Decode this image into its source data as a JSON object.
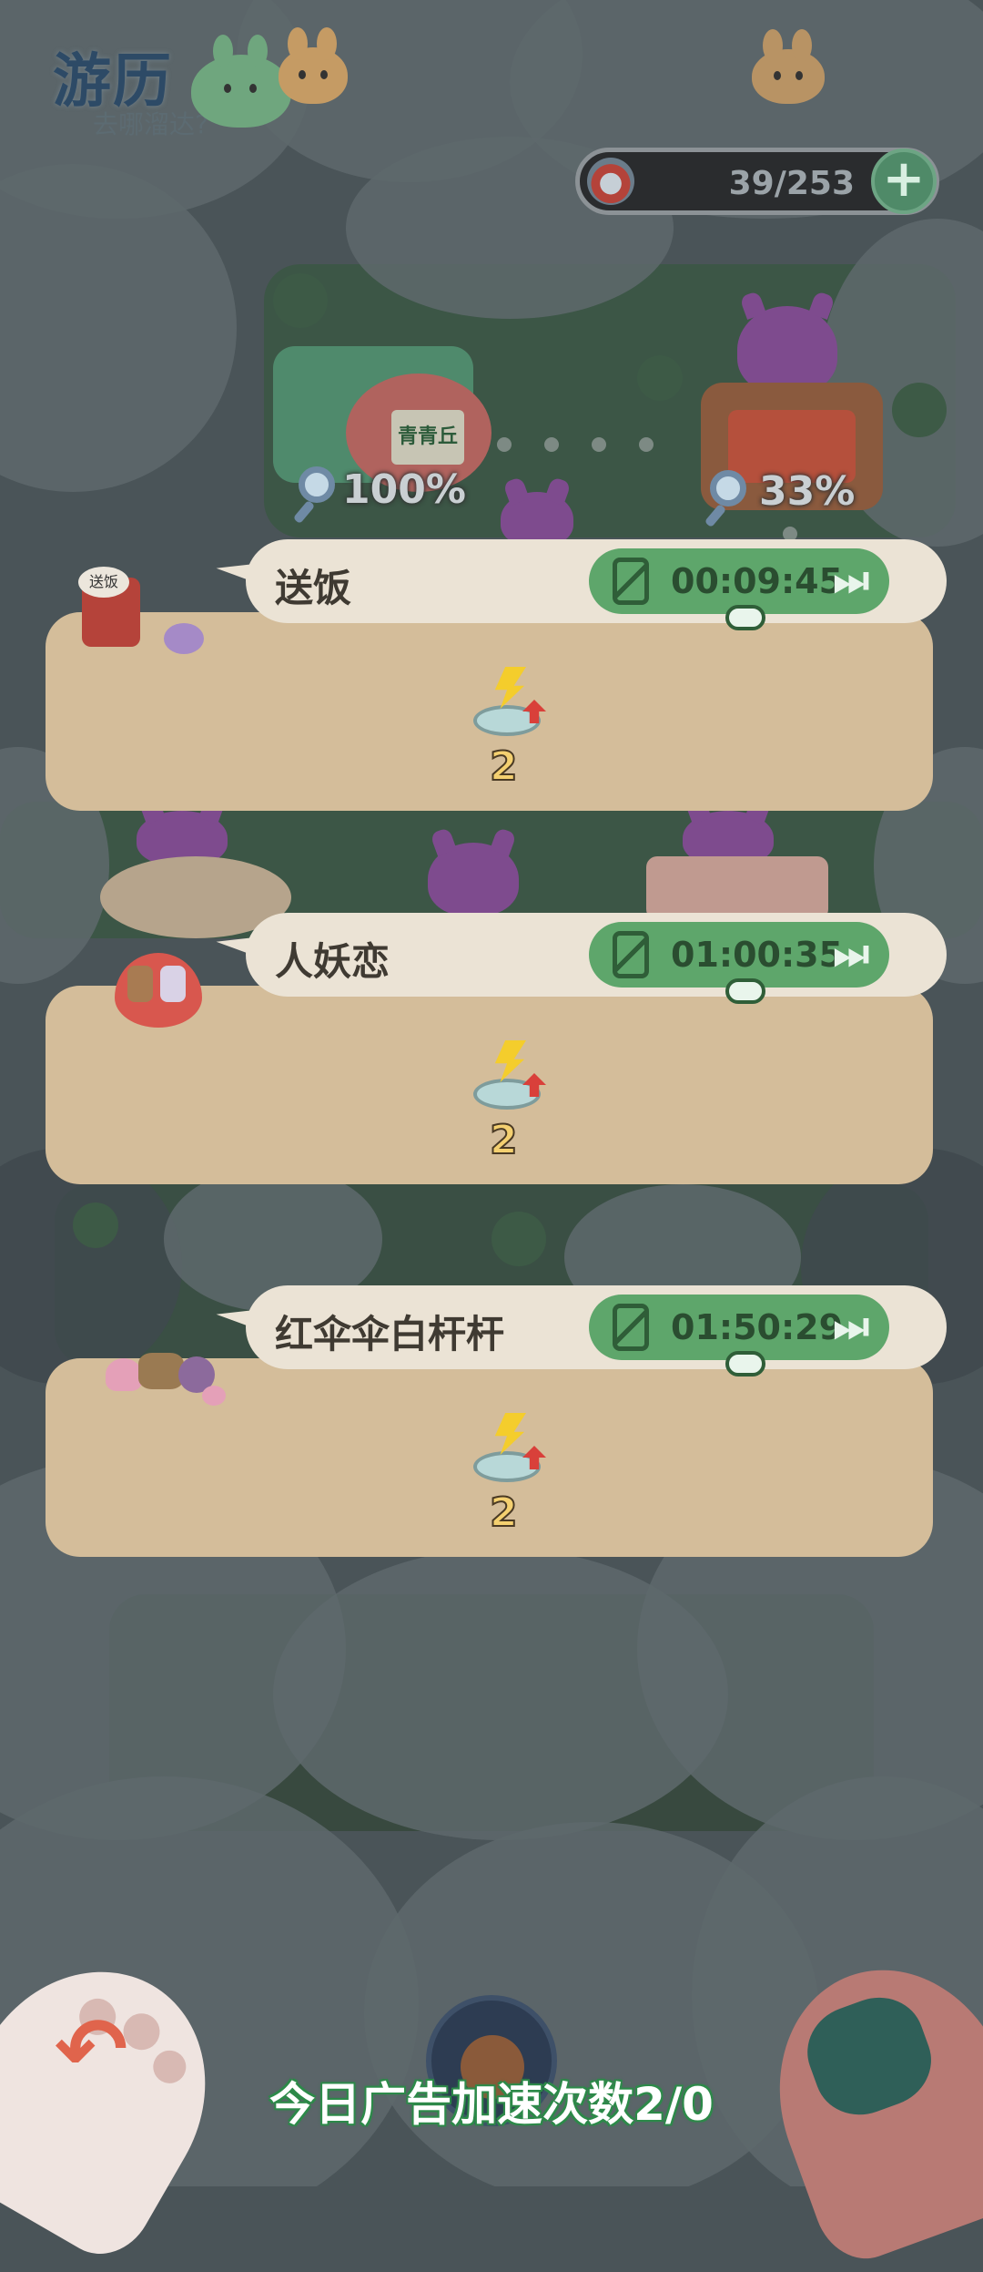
{
  "header": {
    "title": "游历",
    "subtitle": "去哪溜达?"
  },
  "energy": {
    "count": "39/253",
    "add_icon": "plus-icon"
  },
  "landmarks": [
    {
      "percent": "100%",
      "sign": "青青丘"
    },
    {
      "percent": "33%"
    }
  ],
  "tasks": [
    {
      "name": "送饭",
      "badge": "送饭",
      "timer": "00:09:45",
      "reward_count": "2"
    },
    {
      "name": "人妖恋",
      "timer": "01:00:35",
      "reward_count": "2"
    },
    {
      "name": "红伞伞白杆杆",
      "timer": "01:50:29",
      "reward_count": "2"
    }
  ],
  "footer": {
    "ad_speedup_text": "今日广告加速次数2/0"
  },
  "colors": {
    "timer_green": "#5ea66b",
    "card_tan": "#d4bd9a",
    "bubble_cream": "#ebe3d5",
    "energy_plus": "#4f8a68"
  }
}
